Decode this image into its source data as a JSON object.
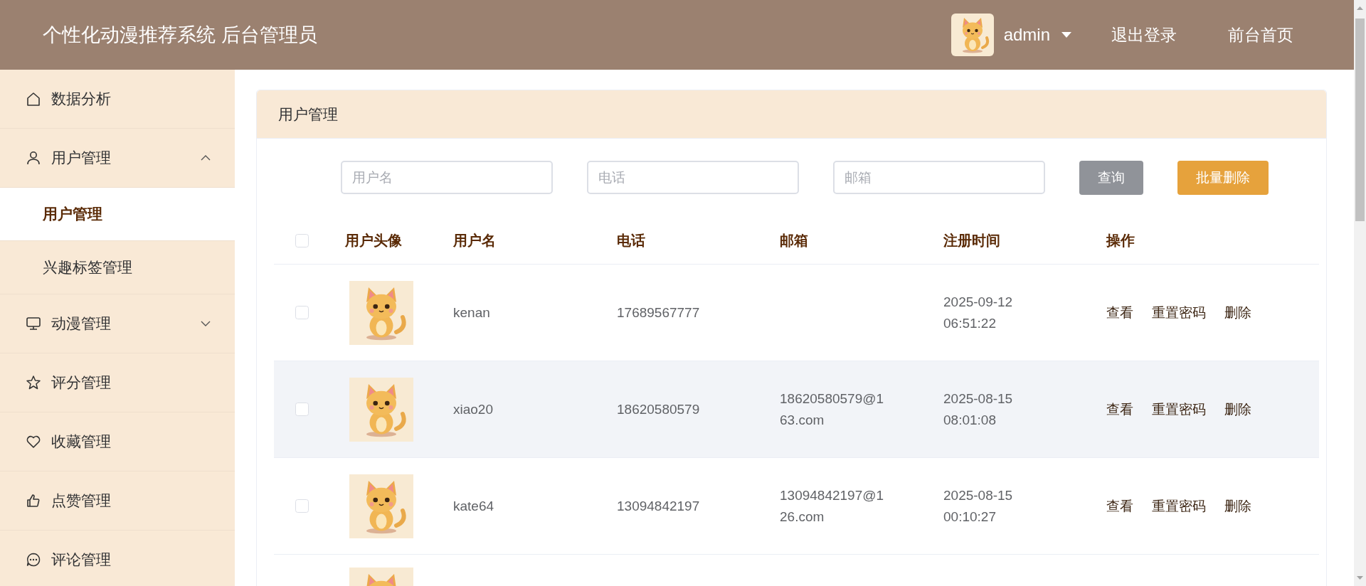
{
  "header": {
    "title": "个性化动漫推荐系统 后台管理员",
    "user": "admin",
    "links": [
      "退出登录",
      "前台首页"
    ]
  },
  "sidebar": {
    "items": [
      {
        "label": "数据分析"
      },
      {
        "label": "用户管理",
        "expanded": true,
        "children": [
          {
            "label": "用户管理",
            "selected": true
          },
          {
            "label": "兴趣标签管理",
            "selected": false
          }
        ]
      },
      {
        "label": "动漫管理",
        "expanded": false
      },
      {
        "label": "评分管理"
      },
      {
        "label": "收藏管理"
      },
      {
        "label": "点赞管理"
      },
      {
        "label": "评论管理"
      }
    ]
  },
  "panel": {
    "title": "用户管理",
    "filters": [
      {
        "placeholder": "用户名"
      },
      {
        "placeholder": "电话"
      },
      {
        "placeholder": "邮箱"
      }
    ],
    "buttons": [
      {
        "label": "查询",
        "kind": "query"
      },
      {
        "label": "批量删除",
        "kind": "danger"
      }
    ]
  },
  "table": {
    "select_all_checked": false,
    "columns": [
      "用户头像",
      "用户名",
      "电话",
      "邮箱",
      "注册时间",
      "操作"
    ],
    "rows": [
      {
        "kind": "full",
        "checked": false,
        "username": "kenan",
        "phone": "17689567777",
        "registered": [
          "2025-09-12",
          "06:51:22"
        ],
        "actions": [
          "查看",
          "重置密码",
          "删除"
        ]
      },
      {
        "kind": "full",
        "checked": false,
        "hovered": true,
        "username": "xiao20",
        "phone": "18620580579",
        "email": "18620580579@163.com",
        "registered": [
          "2025-08-15",
          "08:01:08"
        ],
        "actions": [
          "查看",
          "重置密码",
          "删除"
        ]
      },
      {
        "kind": "full",
        "checked": false,
        "username": "kate64",
        "phone": "13094842197",
        "email": "13094842197@126.com",
        "registered": [
          "2025-08-15",
          "00:10:27"
        ],
        "actions": [
          "查看",
          "重置密码",
          "删除"
        ]
      },
      {
        "kind": "cut"
      }
    ]
  }
}
